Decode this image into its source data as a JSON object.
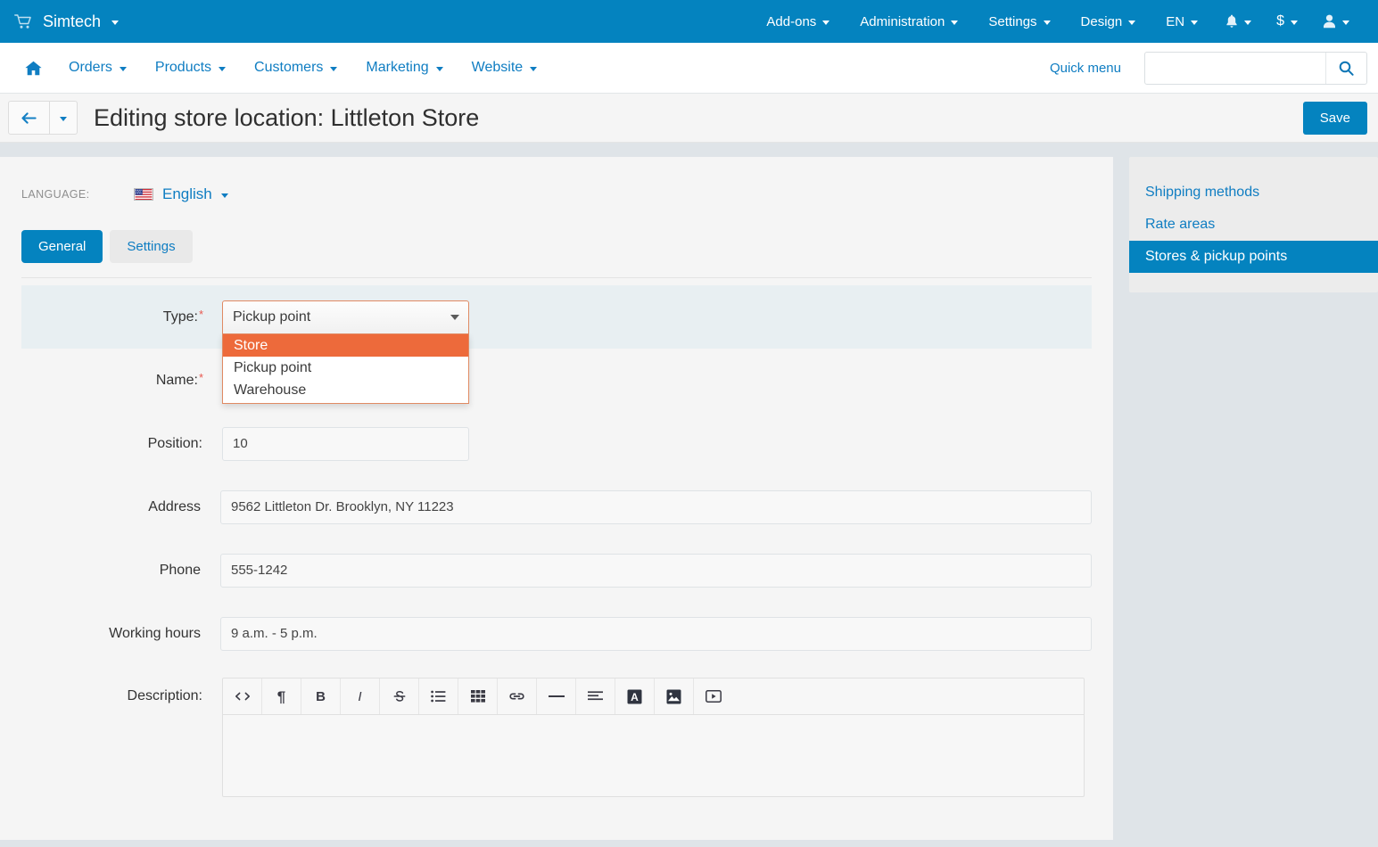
{
  "topbar": {
    "brand": "Simtech",
    "brand_icon": "cart-icon",
    "menu": [
      {
        "label": "Add-ons"
      },
      {
        "label": "Administration"
      },
      {
        "label": "Settings"
      },
      {
        "label": "Design"
      },
      {
        "label": "EN"
      }
    ],
    "icons": [
      {
        "name": "bell-icon"
      },
      {
        "name": "currency-icon",
        "label": "$"
      },
      {
        "name": "user-icon"
      }
    ],
    "accent_color": "#0483bf"
  },
  "subnav": {
    "home_icon": "home-icon",
    "items": [
      {
        "label": "Orders"
      },
      {
        "label": "Products"
      },
      {
        "label": "Customers"
      },
      {
        "label": "Marketing"
      },
      {
        "label": "Website"
      }
    ],
    "quick_menu": "Quick menu",
    "search": {
      "value": "",
      "placeholder": "",
      "icon": "search-icon"
    }
  },
  "titlebar": {
    "back_icon": "arrow-left-icon",
    "title": "Editing store location: Littleton Store",
    "save_label": "Save"
  },
  "language": {
    "label": "LANGUAGE:",
    "flag": "us-flag-icon",
    "value": "English"
  },
  "tabs": [
    {
      "label": "General",
      "active": true
    },
    {
      "label": "Settings",
      "active": false
    }
  ],
  "form": {
    "type": {
      "label": "Type:",
      "required": "*",
      "value": "Pickup point",
      "open": true,
      "options": [
        {
          "label": "Store",
          "highlighted": true
        },
        {
          "label": "Pickup point",
          "highlighted": false
        },
        {
          "label": "Warehouse",
          "highlighted": false
        }
      ],
      "highlight_color": "#ed6a3b"
    },
    "name": {
      "label": "Name:",
      "required": "*",
      "value": ""
    },
    "position": {
      "label": "Position:",
      "value": "10"
    },
    "address": {
      "label": "Address",
      "value": "9562 Littleton Dr. Brooklyn, NY 11223"
    },
    "phone": {
      "label": "Phone",
      "value": "555-1242"
    },
    "working_hours": {
      "label": "Working hours",
      "value": "9 a.m. - 5 p.m."
    },
    "description": {
      "label": "Description:",
      "value": "",
      "toolbar": [
        {
          "name": "source-code-icon",
          "title": "<>"
        },
        {
          "name": "paragraph-icon",
          "title": "¶"
        },
        {
          "name": "bold-icon",
          "title": "B"
        },
        {
          "name": "italic-icon",
          "title": "I"
        },
        {
          "name": "strikethrough-icon",
          "title": "S"
        },
        {
          "name": "unordered-list-icon",
          "title": "list"
        },
        {
          "name": "table-icon",
          "title": "table"
        },
        {
          "name": "link-icon",
          "title": "link"
        },
        {
          "name": "horizontal-rule-icon",
          "title": "hr"
        },
        {
          "name": "align-left-icon",
          "title": "align"
        },
        {
          "name": "text-color-icon",
          "title": "A"
        },
        {
          "name": "image-icon",
          "title": "image"
        },
        {
          "name": "video-icon",
          "title": "video"
        }
      ]
    }
  },
  "sidebar": {
    "items": [
      {
        "label": "Shipping methods",
        "active": false
      },
      {
        "label": "Rate areas",
        "active": false
      },
      {
        "label": "Stores & pickup points",
        "active": true
      }
    ]
  }
}
